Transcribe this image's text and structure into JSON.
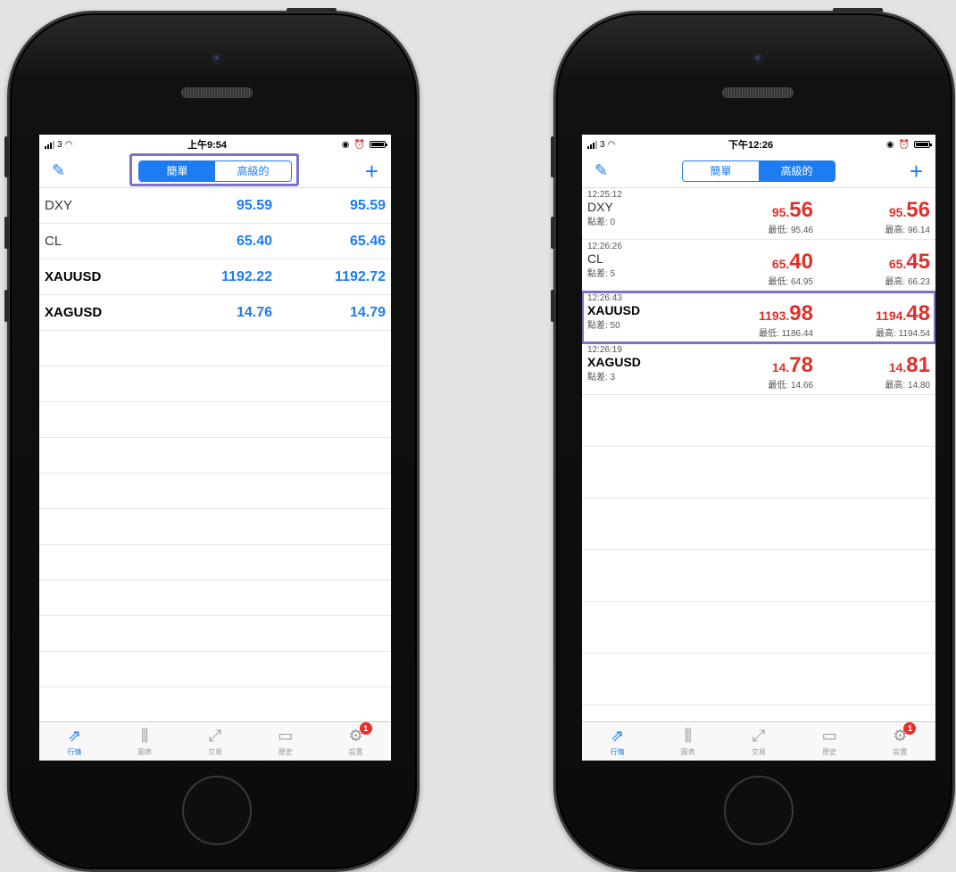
{
  "left_phone": {
    "status": {
      "carrier": "3",
      "time": "上午9:54"
    },
    "nav": {
      "edit_icon": "pencil-icon",
      "segment": [
        "簡單",
        "高級的"
      ],
      "add_icon": "plus-icon"
    },
    "quotes": [
      {
        "symbol": "DXY",
        "bid": "95.59",
        "ask": "95.59"
      },
      {
        "symbol": "CL",
        "bid": "65.40",
        "ask": "65.46"
      },
      {
        "symbol": "XAUUSD",
        "bid": "1192.22",
        "ask": "1192.72"
      },
      {
        "symbol": "XAGUSD",
        "bid": "14.76",
        "ask": "14.79"
      }
    ],
    "tabs": [
      "行情",
      "圖表",
      "交易",
      "歷史",
      "設置"
    ],
    "badge": "1"
  },
  "right_phone": {
    "status": {
      "carrier": "3",
      "time": "下午12:26"
    },
    "nav": {
      "segment": [
        "簡單",
        "高級的"
      ]
    },
    "quotes": [
      {
        "time": "12:25:12",
        "symbol": "DXY",
        "spread": "點差: 0",
        "bid_small": "95.",
        "bid_big": "56",
        "low": "最低: 95.46",
        "ask_small": "95.",
        "ask_big": "56",
        "high": "最高: 96.14"
      },
      {
        "time": "12:26:26",
        "symbol": "CL",
        "spread": "點差: 5",
        "bid_small": "65.",
        "bid_big": "40",
        "low": "最低: 64.95",
        "ask_small": "65.",
        "ask_big": "45",
        "high": "最高: 66.23"
      },
      {
        "time": "12:26:43",
        "symbol": "XAUUSD",
        "spread": "點差: 50",
        "bid_small": "1193.",
        "bid_big": "98",
        "low": "最低: 1186.44",
        "ask_small": "1194.",
        "ask_big": "48",
        "high": "最高: 1194.54"
      },
      {
        "time": "12:26:19",
        "symbol": "XAGUSD",
        "spread": "點差: 3",
        "bid_small": "14.",
        "bid_big": "78",
        "low": "最低: 14.66",
        "ask_small": "14.",
        "ask_big": "81",
        "high": "最高: 14.80"
      }
    ],
    "tabs": [
      "行情",
      "圖表",
      "交易",
      "歷史",
      "設置"
    ],
    "badge": "1"
  },
  "colors": {
    "accent": "#1e7cf2",
    "price_red": "#e0302a",
    "highlight": "#7b72c9"
  }
}
